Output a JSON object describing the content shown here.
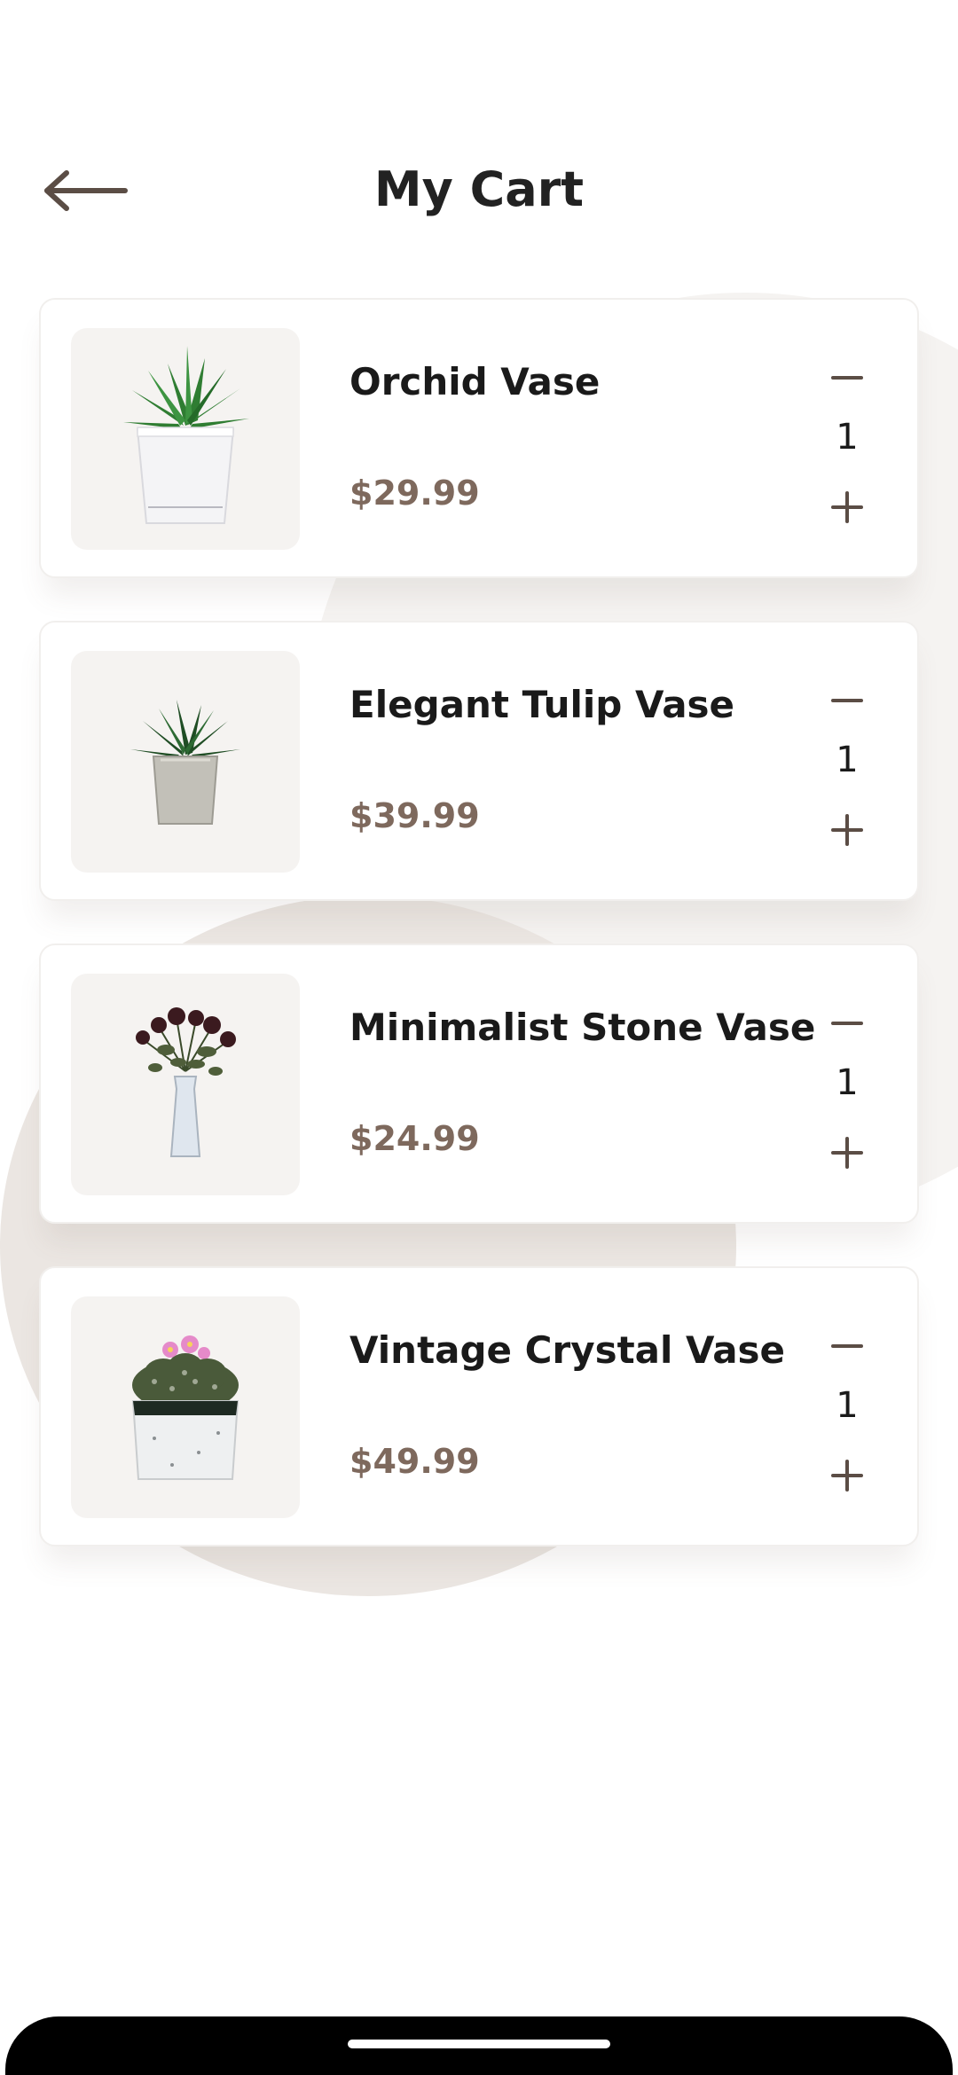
{
  "header": {
    "title": "My Cart",
    "back_icon": "arrow-left-icon"
  },
  "cart": {
    "items": [
      {
        "name": "Orchid Vase",
        "price": "$29.99",
        "quantity": "1",
        "image": "succulent-white-pot"
      },
      {
        "name": "Elegant Tulip Vase",
        "price": "$39.99",
        "quantity": "1",
        "image": "succulent-grey-pot"
      },
      {
        "name": "Minimalist Stone Vase",
        "price": "$24.99",
        "quantity": "1",
        "image": "dried-roses-vase"
      },
      {
        "name": "Vintage Crystal Vase",
        "price": "$49.99",
        "quantity": "1",
        "image": "flowering-cactus-pot"
      }
    ]
  },
  "colors": {
    "price": "#7e695d",
    "icon": "#5b4d45",
    "thumb_bg": "#f5f3f1",
    "blob": "#ebe6e2"
  }
}
